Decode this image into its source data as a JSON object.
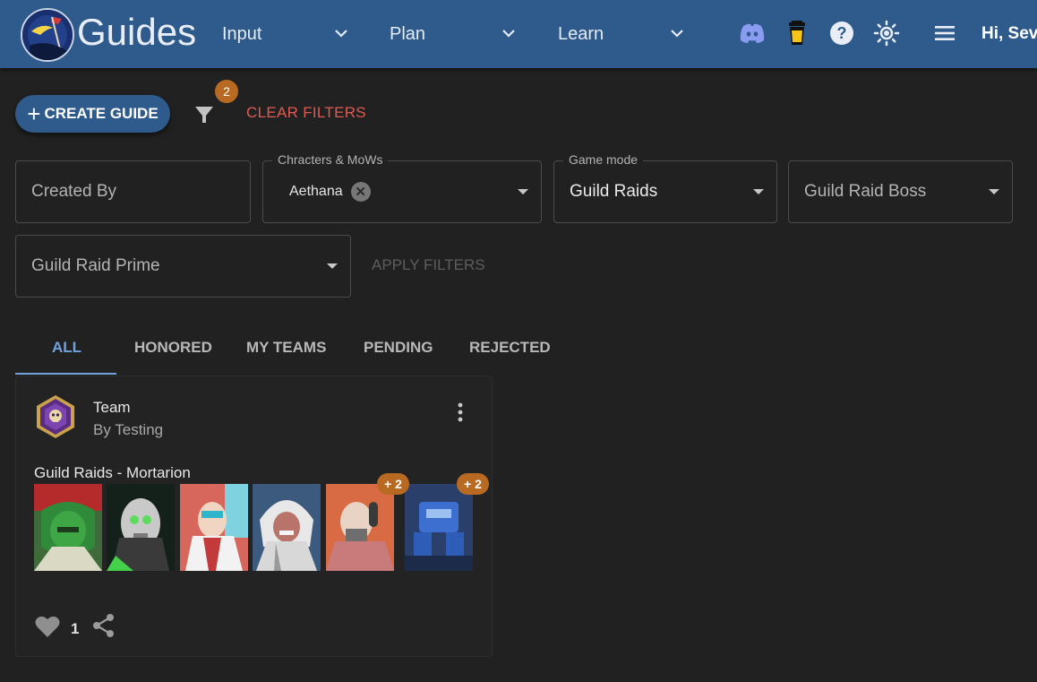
{
  "header": {
    "brand": "Guides",
    "nav": [
      {
        "label": "Input"
      },
      {
        "label": "Plan"
      },
      {
        "label": "Learn"
      }
    ],
    "greeting": "Hi, Sev",
    "icons": [
      "discord-icon",
      "coffee-cup-icon",
      "help-icon",
      "theme-sun-icon",
      "menu-icon"
    ],
    "colors": {
      "bar": "#2e5a8c",
      "discord": "#7289da",
      "coffee": "#f5c518"
    }
  },
  "actions": {
    "create_label": "CREATE GUIDE",
    "filter_badge": "2",
    "clear_label": "CLEAR FILTERS",
    "apply_label": "APPLY FILTERS"
  },
  "filters": {
    "created_by": {
      "placeholder": "Created By"
    },
    "characters": {
      "legend": "Chracters & MoWs",
      "chip": "Aethana"
    },
    "game_mode": {
      "legend": "Game mode",
      "value": "Guild Raids"
    },
    "raid_boss": {
      "placeholder": "Guild Raid Boss"
    },
    "raid_prime": {
      "placeholder": "Guild Raid Prime"
    }
  },
  "tabs": [
    {
      "label": "ALL",
      "active": true
    },
    {
      "label": "HONORED"
    },
    {
      "label": "MY TEAMS"
    },
    {
      "label": "PENDING"
    },
    {
      "label": "REJECTED"
    }
  ],
  "card": {
    "title": "Team",
    "author": "By Testing",
    "mode": "Guild Raids - Mortarion",
    "extra_badges": [
      "+ 2",
      "+ 2"
    ],
    "likes": "1",
    "portraits": [
      "green-space-marine",
      "necron-lord",
      "eldar-warrior",
      "ork-elder",
      "mutant-brute",
      "blue-dreadnought"
    ]
  }
}
